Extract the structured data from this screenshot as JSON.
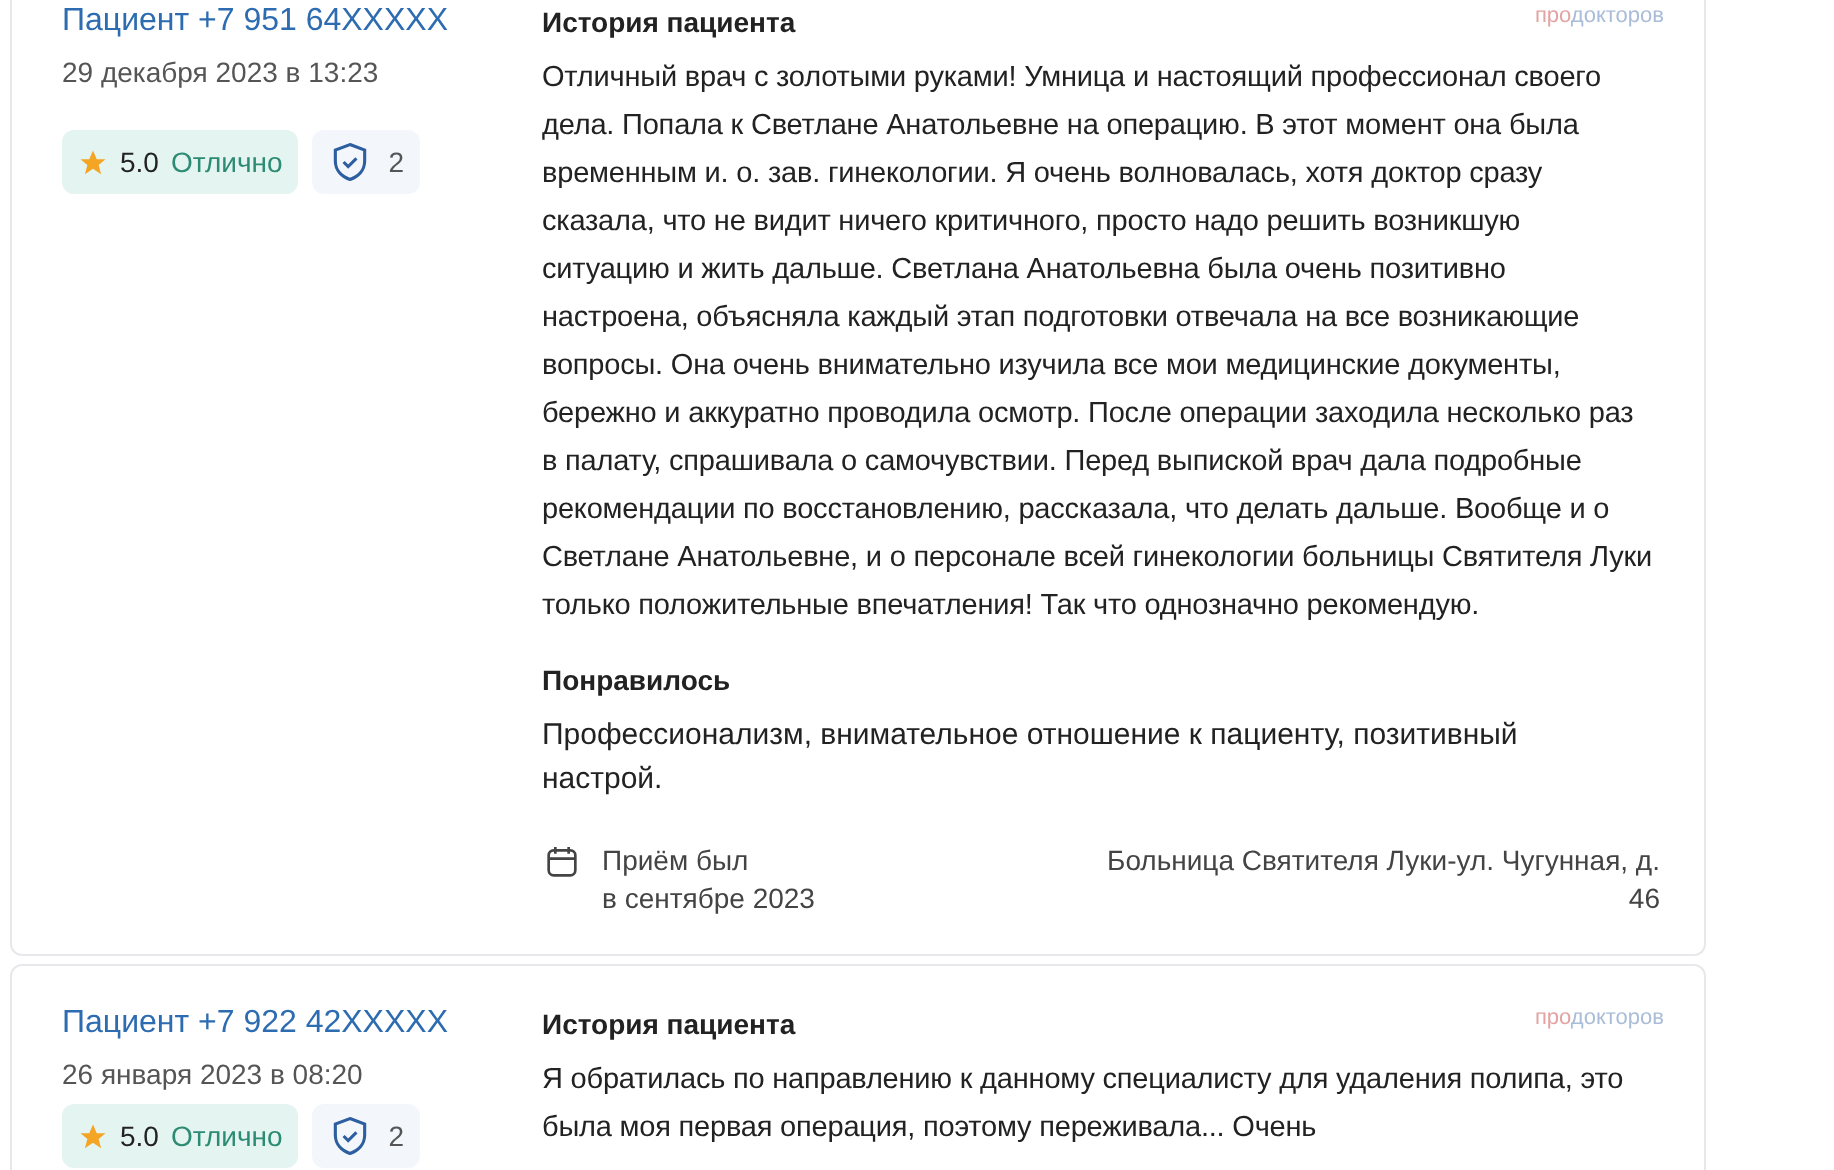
{
  "reviews": [
    {
      "author": "Пациент +7 951 64XXXXX",
      "date": "29 декабря 2023 в 13:23",
      "rating": "5.0",
      "rating_label": "Отлично",
      "verified_count": "2",
      "section_title": "История пациента",
      "brand": [
        "про",
        "докторов"
      ],
      "story": "Отличный врач с золотыми руками! Умница и настоящий профессионал своего дела. Попала к Светлане Анатольевне на операцию. В этот момент она была временным и. о. зав. гинекологии. Я очень волновалась, хотя доктор сразу сказала, что не видит ничего критичного, просто надо решить возникшую ситуацию и жить дальше. Светлана Анатольевна была очень позитивно настроена, объясняла каждый этап подготовки отвечала на все возникающие вопросы. Она очень внимательно изучила все мои медицинские документы, бережно и аккуратно проводила осмотр. После операции заходила несколько раз в палату, спрашивала о самочувствии. Перед выпиской врач дала подробные рекомендации по восстановлению, рассказала, что делать дальше. Вообще и о Светлане Анатольевне, и о персонале всей гинекологии больницы Святителя Луки только положительные впечатления! Так что однозначно рекомендую.",
      "liked_title": "Понравилось",
      "liked": "Профессионализм, внимательное отношение к пациенту, позитивный настрой.",
      "visit": [
        "Приём был",
        "в сентябре 2023"
      ],
      "clinic": "Больница Святителя Луки-ул. Чугунная, д. 46"
    },
    {
      "author": "Пациент +7 922 42XXXXX",
      "date": "26 января 2023 в 08:20",
      "rating": "5.0",
      "rating_label": "Отлично",
      "verified_count": "2",
      "section_title": "История пациента",
      "brand": [
        "про",
        "докторов"
      ],
      "story": "Я обратилась по направлению к данному специалисту для удаления полипа, это была моя первая операция, поэтому переживала... Очень"
    }
  ]
}
